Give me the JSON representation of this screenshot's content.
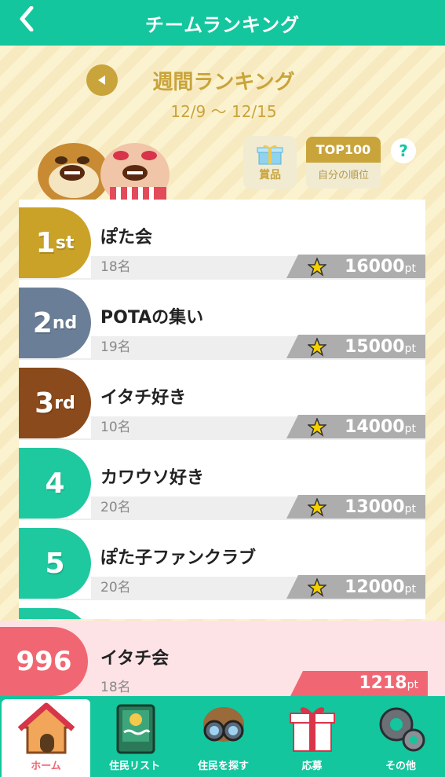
{
  "header": {
    "back_icon": "‹",
    "title": "チームランキング"
  },
  "week": {
    "title": "週間ランキング",
    "range": "12/9 〜 12/15",
    "prev_icon": "◀"
  },
  "actions": {
    "prize_label": "賞品",
    "top_label": "TOP100",
    "my_rank_label": "自分の順位",
    "help_label": "?"
  },
  "ranking": [
    {
      "rank": "1",
      "suffix": "st",
      "name": "ぽた会",
      "members": "18名",
      "points": "16000",
      "unit": "pt",
      "color": "#c9a227"
    },
    {
      "rank": "2",
      "suffix": "nd",
      "name": "POTAの集い",
      "members": "19名",
      "points": "15000",
      "unit": "pt",
      "color": "#6a7f97"
    },
    {
      "rank": "3",
      "suffix": "rd",
      "name": "イタチ好き",
      "members": "10名",
      "points": "14000",
      "unit": "pt",
      "color": "#8a4a1c"
    },
    {
      "rank": "4",
      "suffix": "",
      "name": "カワウソ好き",
      "members": "20名",
      "points": "13000",
      "unit": "pt",
      "color": "#1fc9a0"
    },
    {
      "rank": "5",
      "suffix": "",
      "name": "ぽた子ファンクラブ",
      "members": "20名",
      "points": "12000",
      "unit": "pt",
      "color": "#1fc9a0"
    }
  ],
  "my_team": {
    "rank": "996",
    "name": "イタチ会",
    "members": "18名",
    "points": "1218",
    "unit": "pt"
  },
  "nav": [
    {
      "label": "ホーム",
      "icon": "home-icon"
    },
    {
      "label": "住民リスト",
      "icon": "book-icon"
    },
    {
      "label": "住民を探す",
      "icon": "binoculars-icon"
    },
    {
      "label": "応募",
      "icon": "gift-icon"
    },
    {
      "label": "その他",
      "icon": "gear-icon"
    }
  ],
  "colors": {
    "primary": "#13c69e",
    "gold": "#c9a43a",
    "pink": "#f06773"
  }
}
